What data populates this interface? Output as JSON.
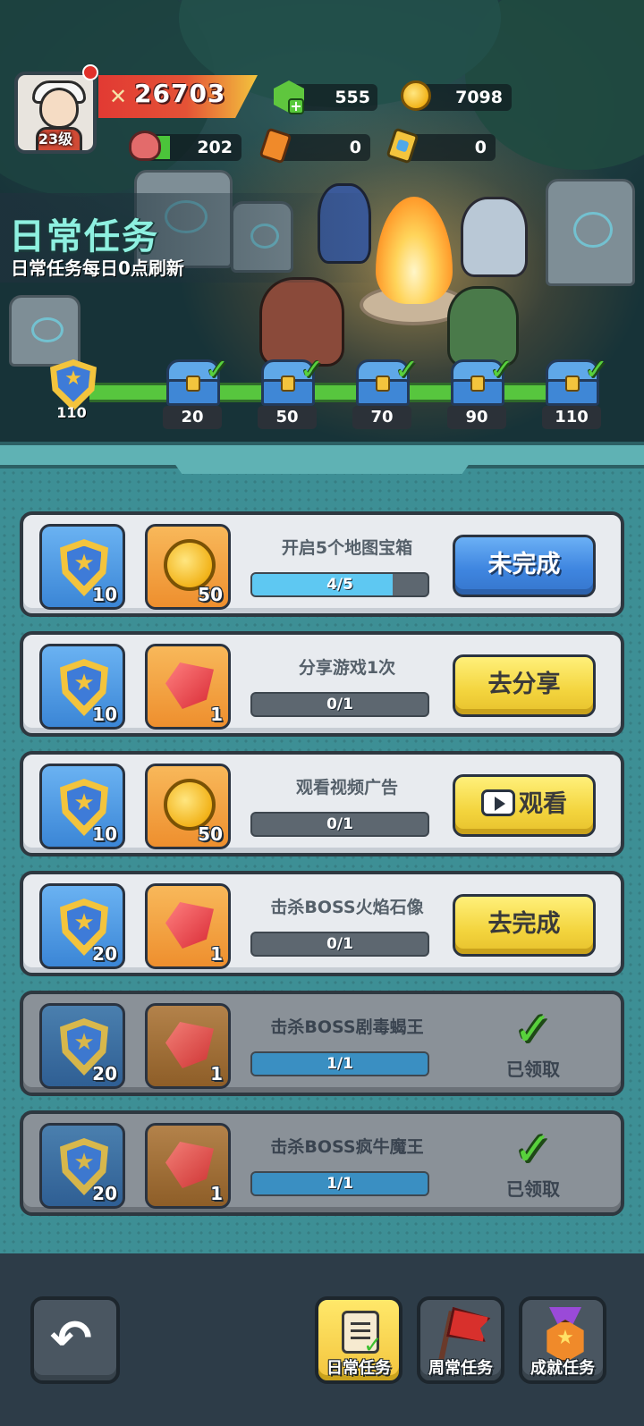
{
  "player": {
    "level": "23级",
    "power": "26703"
  },
  "resources": {
    "gems": "555",
    "coins": "7098",
    "stamina": "202",
    "ticket_a": "0",
    "ticket_b": "0"
  },
  "header": {
    "title": "日常任务",
    "subtitle": "日常任务每日0点刷新"
  },
  "activity": {
    "current": "110",
    "milestones": [
      "20",
      "50",
      "70",
      "90",
      "110"
    ],
    "claimed": [
      true,
      true,
      true,
      true,
      true
    ]
  },
  "tasks": [
    {
      "title": "开启5个地图宝箱",
      "reward1": "10",
      "reward2_type": "coin",
      "reward2": "50",
      "progress_text": "4/5",
      "progress": 0.8,
      "button": "未完成",
      "button_style": "blue",
      "state": "incomplete"
    },
    {
      "title": "分享游戏1次",
      "reward1": "10",
      "reward2_type": "gem",
      "reward2": "1",
      "progress_text": "0/1",
      "progress": 0,
      "button": "去分享",
      "button_style": "yellow",
      "state": "todo"
    },
    {
      "title": "观看视频广告",
      "reward1": "10",
      "reward2_type": "coin",
      "reward2": "50",
      "progress_text": "0/1",
      "progress": 0,
      "button": "观看",
      "button_style": "yellow",
      "state": "todo",
      "button_icon": "tv-icon"
    },
    {
      "title": "击杀BOSS火焰石像",
      "reward1": "20",
      "reward2_type": "gem",
      "reward2": "1",
      "progress_text": "0/1",
      "progress": 0,
      "button": "去完成",
      "button_style": "yellow",
      "state": "todo"
    },
    {
      "title": "击杀BOSS剧毒蝎王",
      "reward1": "20",
      "reward2_type": "gem",
      "reward2": "1",
      "progress_text": "1/1",
      "progress": 1,
      "button": "已领取",
      "state": "claimed"
    },
    {
      "title": "击杀BOSS疯牛魔王",
      "reward1": "20",
      "reward2_type": "gem",
      "reward2": "1",
      "progress_text": "1/1",
      "progress": 1,
      "button": "已领取",
      "state": "claimed"
    }
  ],
  "nav": {
    "tabs": [
      {
        "label": "日常任务",
        "icon": "daily-task-icon",
        "active": true
      },
      {
        "label": "周常任务",
        "icon": "red-flag-icon",
        "active": false
      },
      {
        "label": "成就任务",
        "icon": "medal-icon",
        "active": false
      }
    ],
    "back_icon": "back-arrow-icon"
  },
  "colors": {
    "accent_blue": "#3f86e0",
    "accent_yellow": "#f3c43d",
    "progress_green": "#57c63e",
    "panel_teal": "#3d8f95"
  }
}
